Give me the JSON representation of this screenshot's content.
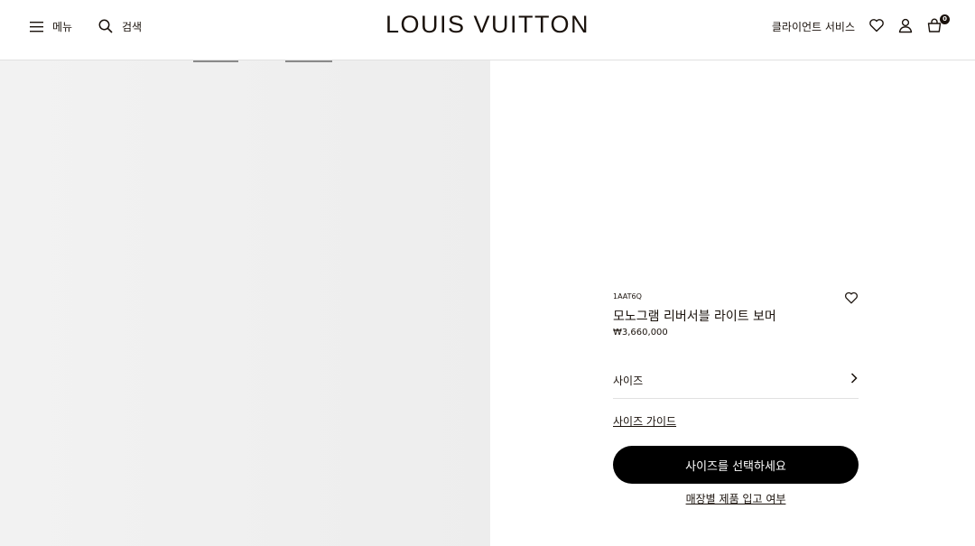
{
  "header": {
    "menu_label": "메뉴",
    "search_label": "검색",
    "brand": "LOUIS VUITTON",
    "client_service": "클라이언트 서비스",
    "cart_count": "0"
  },
  "product": {
    "sku": "1AAT6Q",
    "name": "모노그램 리버서블 라이트 보머",
    "price": "₩3,660,000",
    "size_label": "사이즈",
    "size_guide": "사이즈 가이드",
    "cta_label": "사이즈를 선택하세요",
    "store_stock": "매장별 제품 입고 여부"
  },
  "colors": {
    "text": "#19110b",
    "cta_bg": "#000000",
    "divider": "#e1e1e1",
    "photo_bg": "#efefef"
  },
  "icons": [
    "hamburger-menu-icon",
    "search-icon",
    "heart-icon",
    "user-icon",
    "shopping-bag-icon",
    "chevron-right-icon"
  ]
}
